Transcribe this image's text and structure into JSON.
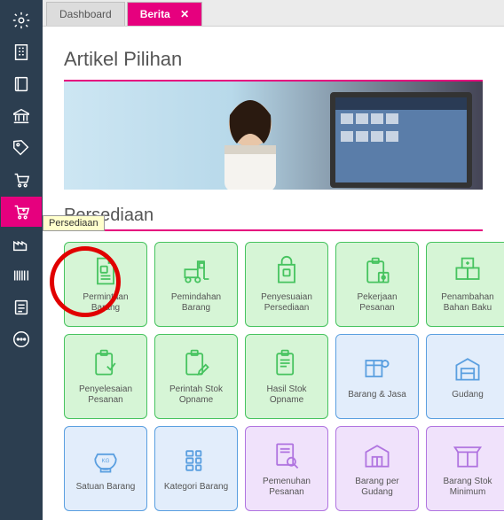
{
  "tabs": {
    "dashboard": "Dashboard",
    "berita": "Berita",
    "close": "✕"
  },
  "titles": {
    "main": "Artikel Pilihan",
    "section": "Persediaan"
  },
  "tooltip": "Persediaan",
  "cards": {
    "permintaan_barang": "Permintaan Barang",
    "pemindahan_barang": "Pemindahan Barang",
    "penyesuaian_persediaan": "Penyesuaian Persediaan",
    "pekerjaan_pesanan": "Pekerjaan Pesanan",
    "penambahan_bahan_baku": "Penambahan Bahan Baku",
    "penyelesaian_pesanan": "Penyelesaian Pesanan",
    "perintah_stok_opname": "Perintah Stok Opname",
    "hasil_stok_opname": "Hasil Stok Opname",
    "barang_jasa": "Barang & Jasa",
    "gudang": "Gudang",
    "satuan_barang": "Satuan Barang",
    "kategori_barang": "Kategori Barang",
    "pemenuhan_pesanan": "Pemenuhan Pesanan",
    "barang_per_gudang": "Barang per Gudang",
    "barang_stok_minimum": "Barang Stok Minimum"
  },
  "colors": {
    "accent": "#e6007e",
    "sidebar": "#2c3e50"
  }
}
